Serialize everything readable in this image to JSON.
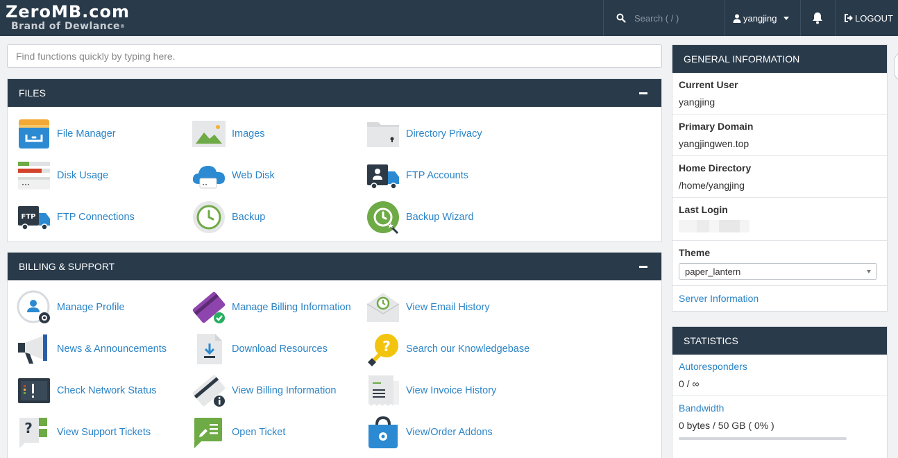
{
  "brand": {
    "name": "ZeroMB.com",
    "tagline": "Brand of Dewlance",
    "tm": "®"
  },
  "topbar": {
    "search_placeholder": "Search ( / )",
    "username": "yangjing",
    "logout_label": "LOGOUT"
  },
  "quickfind": {
    "placeholder": "Find functions quickly by typing here."
  },
  "files": {
    "title": "FILES",
    "items": [
      {
        "label": "File Manager",
        "icon": "file-manager-icon"
      },
      {
        "label": "Images",
        "icon": "images-icon"
      },
      {
        "label": "Directory Privacy",
        "icon": "directory-privacy-icon"
      },
      {
        "label": "Disk Usage",
        "icon": "disk-usage-icon"
      },
      {
        "label": "Web Disk",
        "icon": "web-disk-icon"
      },
      {
        "label": "FTP Accounts",
        "icon": "ftp-accounts-icon"
      },
      {
        "label": "FTP Connections",
        "icon": "ftp-connections-icon"
      },
      {
        "label": "Backup",
        "icon": "backup-icon"
      },
      {
        "label": "Backup Wizard",
        "icon": "backup-wizard-icon"
      }
    ]
  },
  "billing": {
    "title": "BILLING & SUPPORT",
    "items": [
      {
        "label": "Manage Profile",
        "icon": "manage-profile-icon"
      },
      {
        "label": "Manage Billing Information",
        "icon": "manage-billing-icon"
      },
      {
        "label": "View Email History",
        "icon": "email-history-icon"
      },
      {
        "label": "News & Announcements",
        "icon": "megaphone-icon"
      },
      {
        "label": "Download Resources",
        "icon": "download-icon"
      },
      {
        "label": "Search our Knowledgebase",
        "icon": "knowledgebase-icon"
      },
      {
        "label": "Check Network Status",
        "icon": "network-status-icon"
      },
      {
        "label": "View Billing Information",
        "icon": "billing-info-icon"
      },
      {
        "label": "View Invoice History",
        "icon": "invoice-icon"
      },
      {
        "label": "View Support Tickets",
        "icon": "support-tickets-icon"
      },
      {
        "label": "Open Ticket",
        "icon": "open-ticket-icon"
      },
      {
        "label": "View/Order Addons",
        "icon": "addons-icon"
      }
    ]
  },
  "general": {
    "title": "GENERAL INFORMATION",
    "current_user_label": "Current User",
    "current_user": "yangjing",
    "primary_domain_label": "Primary Domain",
    "primary_domain": "yangjingwen.top",
    "home_dir_label": "Home Directory",
    "home_dir": "/home/yangjing",
    "last_login_label": "Last Login",
    "theme_label": "Theme",
    "theme_value": "paper_lantern",
    "server_info": "Server Information"
  },
  "statistics": {
    "title": "STATISTICS",
    "autoresponders_label": "Autoresponders",
    "autoresponders_value": "0 / ∞",
    "bandwidth_label": "Bandwidth",
    "bandwidth_value": "0 bytes / 50 GB ( 0% )",
    "bandwidth_fraction": 0
  }
}
